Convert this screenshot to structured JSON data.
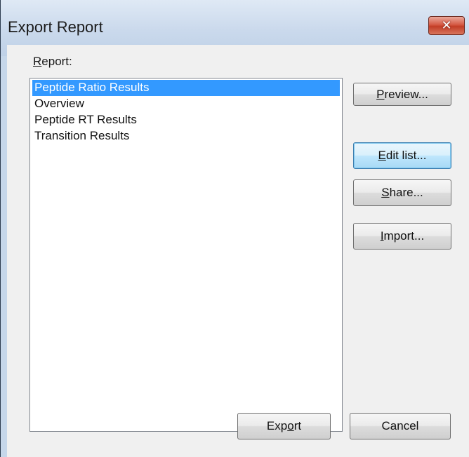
{
  "window": {
    "title": "Export Report",
    "close_glyph": "✕"
  },
  "report_label": {
    "accel": "R",
    "rest": "eport:"
  },
  "report_list": {
    "items": [
      "Peptide Ratio Results",
      "Overview",
      "Peptide RT Results",
      "Transition Results"
    ],
    "selected_index": 0
  },
  "buttons": {
    "preview": {
      "accel": "P",
      "rest": "review..."
    },
    "edit_list": {
      "accel": "E",
      "rest": "dit list..."
    },
    "share": {
      "accel": "S",
      "rest": "hare..."
    },
    "import": {
      "accel": "I",
      "rest": "mport..."
    },
    "export": {
      "pre": "Exp",
      "accel": "o",
      "rest": "rt"
    },
    "cancel": {
      "label": "Cancel"
    }
  },
  "colors": {
    "selection": "#3399ff",
    "close_button": "#c23d26",
    "dialog_background": "#f0f0f0"
  },
  "icons": {
    "close": "close-icon"
  }
}
